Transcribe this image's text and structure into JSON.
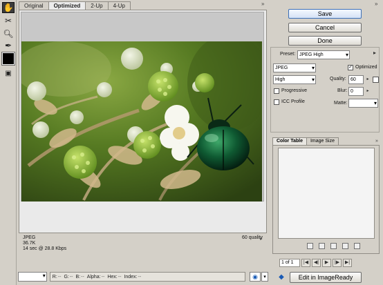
{
  "tabs": [
    "Original",
    "Optimized",
    "2-Up",
    "4-Up"
  ],
  "info": {
    "format": "JPEG",
    "size": "36.7K",
    "time": "14 sec @ 28.8 Kbps",
    "quality": "60 quality"
  },
  "readout": {
    "r": "R:",
    "r_val": "--",
    "g": "G:",
    "g_val": "--",
    "b": "B:",
    "b_val": "--",
    "alpha": "Alpha:",
    "alpha_val": "--",
    "hex": "Hex:",
    "hex_val": "--",
    "index": "Index:",
    "index_val": "--"
  },
  "buttons": {
    "save": "Save",
    "cancel": "Cancel",
    "done": "Done",
    "edit": "Edit in ImageReady"
  },
  "settings": {
    "preset_label": "Preset:",
    "preset_value": "JPEG High",
    "format_value": "JPEG",
    "optimized_label": "Optimized",
    "optimized_checked": true,
    "compression_value": "High",
    "quality_label": "Quality:",
    "quality_value": "60",
    "progressive_label": "Progressive",
    "blur_label": "Blur:",
    "blur_value": "0",
    "icc_label": "ICC Profile",
    "matte_label": "Matte:"
  },
  "color_table": {
    "tabs": [
      "Color Table",
      "Image Size"
    ]
  },
  "animation": {
    "frame": "1 of 1"
  },
  "icons": {
    "tools": [
      "hand-icon",
      "slice-select-icon",
      "zoom-icon",
      "eyedropper-icon"
    ],
    "swatch_color": "#000000"
  }
}
